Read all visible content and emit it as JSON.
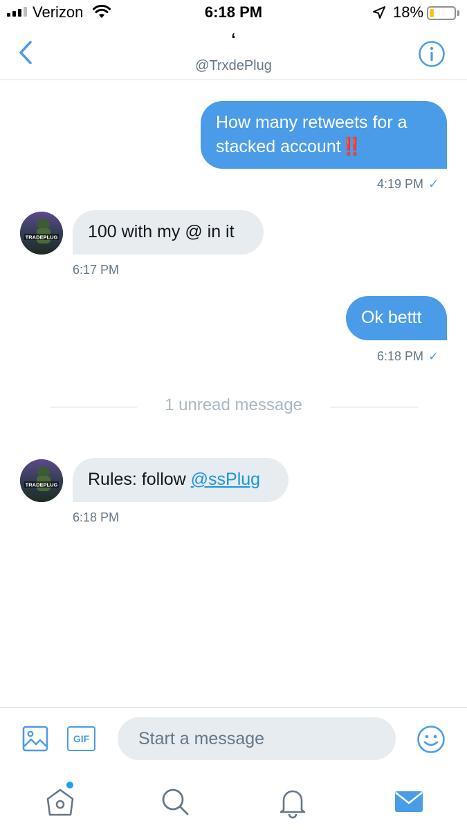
{
  "status_bar": {
    "carrier": "Verizon",
    "time": "6:18 PM",
    "battery_percent": "18%",
    "battery_level": 0.18,
    "icons": [
      "signal-icon",
      "wifi-icon",
      "location-arrow-icon",
      "battery-icon"
    ]
  },
  "header": {
    "display_name": "ʻ",
    "handle": "@TrxdePlug",
    "back_icon": "chevron-left-icon",
    "info_icon": "info-icon"
  },
  "messages": [
    {
      "direction": "outgoing",
      "text": "How many retweets for a stacked account",
      "emoji": "‼️",
      "time": "4:19 PM",
      "status_icon": "✓"
    },
    {
      "direction": "incoming",
      "text": "100 with my @ in it",
      "time": "6:17 PM",
      "avatar_label": "TRADEPLUG"
    },
    {
      "direction": "outgoing",
      "text": "Ok bettt",
      "time": "6:18 PM",
      "status_icon": "✓"
    },
    {
      "direction": "incoming",
      "text": "Rules: follow ",
      "mention": "@ssPlug",
      "time": "6:18 PM",
      "avatar_label": "TRADEPLUG"
    }
  ],
  "unread_divider": "1 unread message",
  "composer": {
    "placeholder": "Start a message",
    "gif_label": "GIF",
    "icons": [
      "image-icon",
      "gif-icon",
      "emoji-icon"
    ]
  },
  "tabbar": {
    "tabs": [
      "home-icon",
      "search-icon",
      "notifications-icon",
      "messages-icon"
    ],
    "active": "messages-icon",
    "colors": {
      "accent": "#4a9ce8",
      "inactive": "#657786"
    }
  }
}
